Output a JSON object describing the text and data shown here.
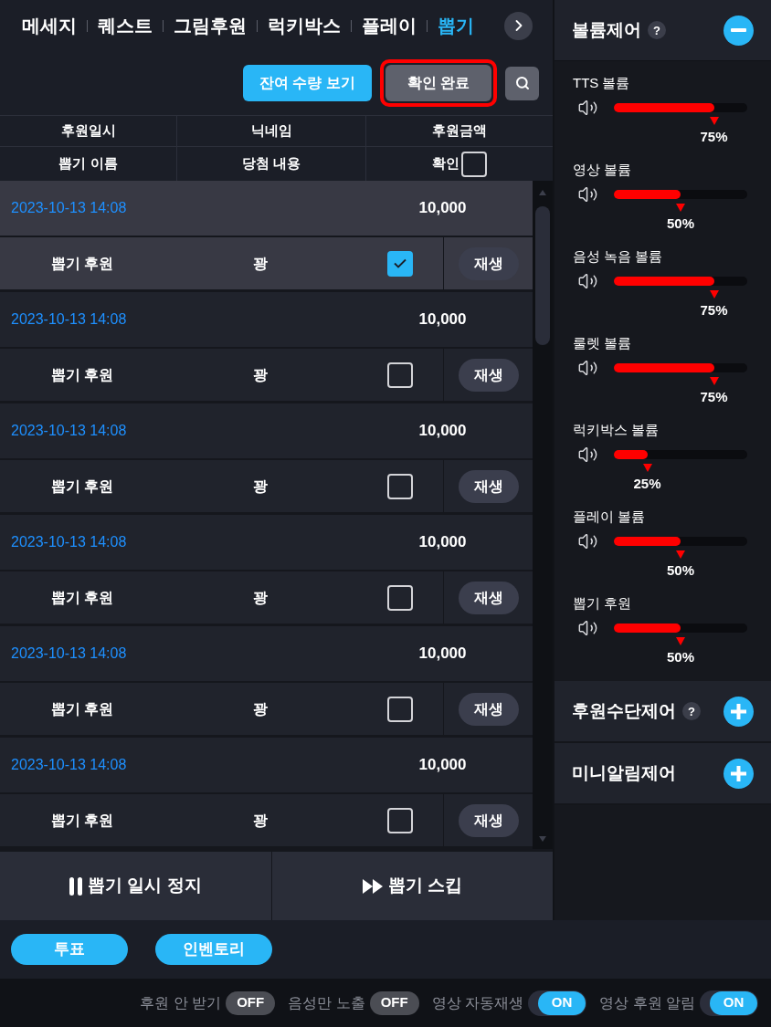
{
  "tabs": [
    {
      "label": "메세지",
      "selected": false
    },
    {
      "label": "퀘스트",
      "selected": false
    },
    {
      "label": "그림후원",
      "selected": false
    },
    {
      "label": "럭키박스",
      "selected": false
    },
    {
      "label": "플레이",
      "selected": false
    },
    {
      "label": "뽑기",
      "selected": true
    }
  ],
  "toolbar": {
    "buttons": [
      {
        "label": "잔여 수량 보기",
        "kind": "primary",
        "highlighted": false
      },
      {
        "label": "확인 완료",
        "kind": "secondary",
        "highlighted": true
      }
    ]
  },
  "table": {
    "header": {
      "row_1": [
        "후원일시",
        "닉네임",
        "후원금액"
      ],
      "row_2": [
        "뽑기 이름",
        "당첨 내용",
        "확인"
      ],
      "select_all_checked": false
    },
    "rows": [
      {
        "date": "2023-10-13 14:08",
        "amount": "10,000",
        "name": "뽑기 후원",
        "result": "꽝",
        "checked": true,
        "selected": true,
        "action": "재생"
      },
      {
        "date": "2023-10-13 14:08",
        "amount": "10,000",
        "name": "뽑기 후원",
        "result": "꽝",
        "checked": false,
        "selected": false,
        "action": "재생"
      },
      {
        "date": "2023-10-13 14:08",
        "amount": "10,000",
        "name": "뽑기 후원",
        "result": "꽝",
        "checked": false,
        "selected": false,
        "action": "재생"
      },
      {
        "date": "2023-10-13 14:08",
        "amount": "10,000",
        "name": "뽑기 후원",
        "result": "꽝",
        "checked": false,
        "selected": false,
        "action": "재생"
      },
      {
        "date": "2023-10-13 14:08",
        "amount": "10,000",
        "name": "뽑기 후원",
        "result": "꽝",
        "checked": false,
        "selected": false,
        "action": "재생"
      },
      {
        "date": "2023-10-13 14:08",
        "amount": "10,000",
        "name": "뽑기 후원",
        "result": "꽝",
        "checked": false,
        "selected": false,
        "action": "재생"
      }
    ]
  },
  "controls": [
    {
      "label": "뽑기 일시 정지",
      "kind": "pause"
    },
    {
      "label": "뽑기 스킵",
      "kind": "skip"
    }
  ],
  "sidebar": {
    "sections": [
      {
        "title": "볼륨제어",
        "help": "?",
        "expanded": true,
        "sliders": [
          {
            "label": "TTS 볼륨",
            "level": 0.75,
            "reading": "75%"
          },
          {
            "label": "영상 볼륨",
            "level": 0.5,
            "reading": "50%"
          },
          {
            "label": "음성 녹음 볼륨",
            "level": 0.75,
            "reading": "75%"
          },
          {
            "label": "룰렛 볼륨",
            "level": 0.75,
            "reading": "75%"
          },
          {
            "label": "럭키박스 볼륨",
            "level": 0.25,
            "reading": "25%"
          },
          {
            "label": "플레이 볼륨",
            "level": 0.5,
            "reading": "50%"
          },
          {
            "label": "뽑기 후원",
            "level": 0.5,
            "reading": "50%"
          }
        ]
      },
      {
        "title": "후원수단제어",
        "help": "?",
        "expanded": false
      },
      {
        "title": "미니알림제어",
        "expanded": false
      }
    ]
  },
  "bottom_buttons": [
    "투표",
    "인벤토리"
  ],
  "toggles": [
    {
      "label": "후원 안 받기",
      "on": false,
      "state": "OFF"
    },
    {
      "label": "음성만 노출",
      "on": false,
      "state": "OFF"
    },
    {
      "label": "영상 자동재생",
      "on": true,
      "state": "ON"
    },
    {
      "label": "영상 후원 알림",
      "on": true,
      "state": "ON"
    }
  ]
}
